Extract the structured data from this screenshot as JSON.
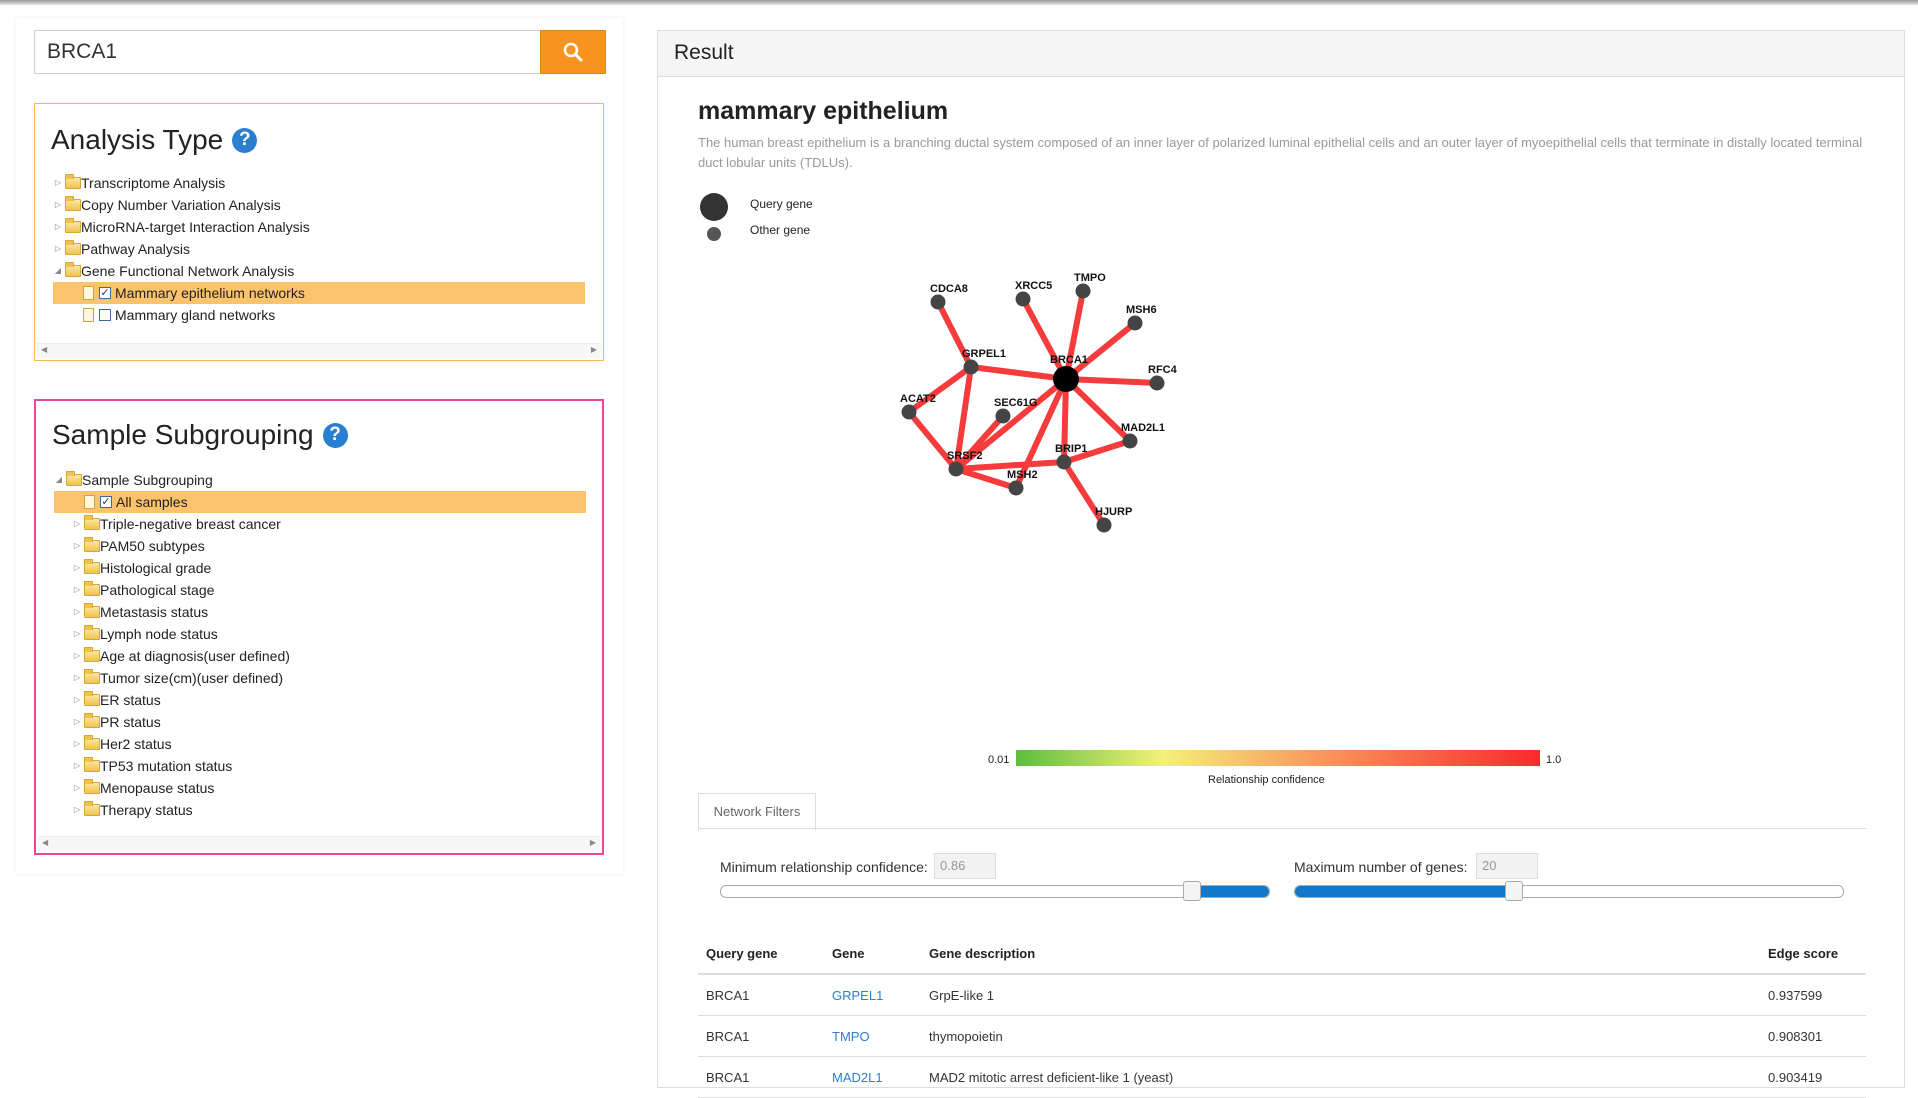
{
  "search": {
    "value": "BRCA1"
  },
  "analysis_type": {
    "title": "Analysis Type",
    "help_glyph": "?",
    "items": [
      {
        "label": "Transcriptome Analysis"
      },
      {
        "label": "Copy Number Variation Analysis"
      },
      {
        "label": "MicroRNA-target Interaction Analysis"
      },
      {
        "label": "Pathway Analysis"
      },
      {
        "label": "Gene Functional Network Analysis",
        "expanded": true,
        "children": [
          {
            "label": "Mammary epithelium networks",
            "checked": true,
            "selected": true
          },
          {
            "label": "Mammary gland networks",
            "checked": false
          }
        ]
      }
    ]
  },
  "sample_subgrouping": {
    "title": "Sample Subgrouping",
    "help_glyph": "?",
    "root_label": "Sample Subgrouping",
    "all_samples": "All samples",
    "items": [
      "Triple-negative breast cancer",
      "PAM50 subtypes",
      "Histological grade",
      "Pathological stage",
      "Metastasis status",
      "Lymph node status",
      "Age at diagnosis(user defined)",
      "Tumor size(cm)(user defined)",
      "ER status",
      "PR status",
      "Her2 status",
      "TP53 mutation status",
      "Menopause status",
      "Therapy status"
    ]
  },
  "result": {
    "header": "Result",
    "tissue_title": "mammary epithelium",
    "tissue_desc": "The human breast epithelium is a branching ductal system composed of an inner layer of polarized luminal epithelial cells and an outer layer of myoepithelial cells that terminate in distally located terminal duct lobular units (TDLUs).",
    "legend_query": "Query gene",
    "legend_other": "Other gene"
  },
  "network": {
    "nodes": [
      {
        "id": "BRCA1",
        "type": "query"
      },
      {
        "id": "CDCA8"
      },
      {
        "id": "XRCC5"
      },
      {
        "id": "TMPO"
      },
      {
        "id": "MSH6"
      },
      {
        "id": "GRPEL1"
      },
      {
        "id": "RFC4"
      },
      {
        "id": "ACAT2"
      },
      {
        "id": "SEC61G"
      },
      {
        "id": "MAD2L1"
      },
      {
        "id": "BRIP1"
      },
      {
        "id": "SRSF2"
      },
      {
        "id": "MSH2"
      },
      {
        "id": "HJURP"
      }
    ],
    "edges": [
      [
        "BRCA1",
        "XRCC5"
      ],
      [
        "BRCA1",
        "TMPO"
      ],
      [
        "BRCA1",
        "MSH6"
      ],
      [
        "BRCA1",
        "RFC4"
      ],
      [
        "BRCA1",
        "GRPEL1"
      ],
      [
        "BRCA1",
        "MAD2L1"
      ],
      [
        "BRCA1",
        "BRIP1"
      ],
      [
        "BRCA1",
        "SRSF2"
      ],
      [
        "BRCA1",
        "MSH2"
      ],
      [
        "GRPEL1",
        "CDCA8"
      ],
      [
        "GRPEL1",
        "ACAT2"
      ],
      [
        "GRPEL1",
        "SRSF2"
      ],
      [
        "ACAT2",
        "SRSF2"
      ],
      [
        "SEC61G",
        "SRSF2"
      ],
      [
        "SRSF2",
        "BRIP1"
      ],
      [
        "SRSF2",
        "MSH2"
      ],
      [
        "BRIP1",
        "MAD2L1"
      ],
      [
        "BRIP1",
        "HJURP"
      ]
    ],
    "colorbar": {
      "min_label": "0.01",
      "max_label": "1.0",
      "title": "Relationship confidence",
      "colors": [
        "#5cbf3c",
        "#f4f07a",
        "#f8a060",
        "#f92a2a"
      ]
    },
    "edge_color": "#f53b3b",
    "node_color": "#444444",
    "query_color": "#000000"
  },
  "filters": {
    "tab": "Network Filters",
    "min_conf_label": "Minimum relationship confidence:",
    "min_conf_value": "0.86",
    "min_conf_fraction": 0.86,
    "max_genes_label": "Maximum number of genes:",
    "max_genes_value": "20",
    "max_genes_fraction": 0.4
  },
  "table": {
    "headers": [
      "Query gene",
      "Gene",
      "Gene description",
      "Edge score"
    ],
    "rows": [
      [
        "BRCA1",
        "GRPEL1",
        "GrpE-like 1",
        "0.937599"
      ],
      [
        "BRCA1",
        "TMPO",
        "thymopoietin",
        "0.908301"
      ],
      [
        "BRCA1",
        "MAD2L1",
        "MAD2 mitotic arrest deficient-like 1 (yeast)",
        "0.903419"
      ]
    ]
  }
}
